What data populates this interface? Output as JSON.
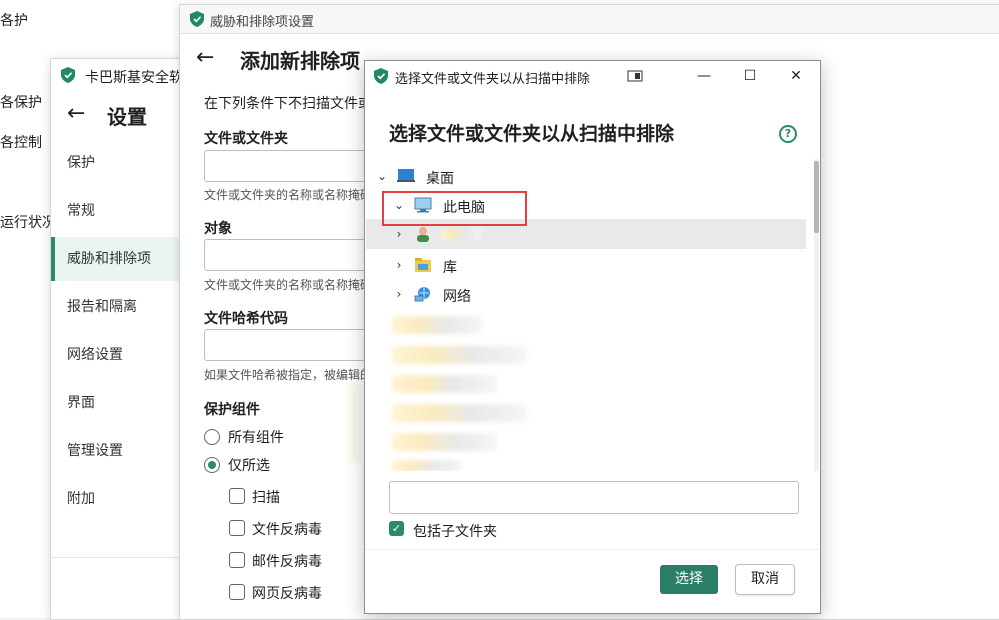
{
  "background": {
    "left_items": [
      "各护",
      "各保护",
      "各控制",
      "运行状况"
    ]
  },
  "settings_window": {
    "title": "卡巴斯基安全软",
    "heading": "设置",
    "nav": [
      {
        "label": "保护",
        "active": false
      },
      {
        "label": "常规",
        "active": false
      },
      {
        "label": "威胁和排除项",
        "active": true
      },
      {
        "label": "报告和隔离",
        "active": false
      },
      {
        "label": "网络设置",
        "active": false
      },
      {
        "label": "界面",
        "active": false
      },
      {
        "label": "管理设置",
        "active": false
      },
      {
        "label": "附加",
        "active": false
      }
    ]
  },
  "exclusion_window": {
    "title": "威胁和排除项设置",
    "heading": "添加新排除项",
    "intro": "在下列条件下不扫描文件或",
    "file_label": "文件或文件夹",
    "file_hint": "文件或文件夹的名称或名称掩码",
    "object_label": "对象",
    "object_hint": "文件或文件夹的名称或名称掩码",
    "hash_label": "文件哈希代码",
    "hash_hint": "如果文件哈希被指定，被编辑的",
    "components_label": "保护组件",
    "radio_all": "所有组件",
    "radio_selected": "仅所选",
    "components": [
      "扫描",
      "文件反病毒",
      "邮件反病毒",
      "网页反病毒"
    ]
  },
  "dialog": {
    "title": "选择文件或文件夹以从扫描中排除",
    "heading": "选择文件或文件夹以从扫描中排除",
    "help": "?",
    "tree": [
      {
        "label": "桌面",
        "icon": "desktop-icon"
      },
      {
        "label": "此电脑",
        "icon": "computer-icon"
      },
      {
        "label": "",
        "icon": "user-folder-icon"
      },
      {
        "label": "库",
        "icon": "library-icon"
      },
      {
        "label": "网络",
        "icon": "network-icon"
      }
    ],
    "path_value": "",
    "include_subfolders": "包括子文件夹",
    "ok_label": "选择",
    "cancel_label": "取消",
    "controls": {
      "minimize": "—",
      "maximize": "☐",
      "close": "✕"
    }
  },
  "colors": {
    "accent": "#2a8a6a",
    "highlight_border": "#e14040"
  }
}
